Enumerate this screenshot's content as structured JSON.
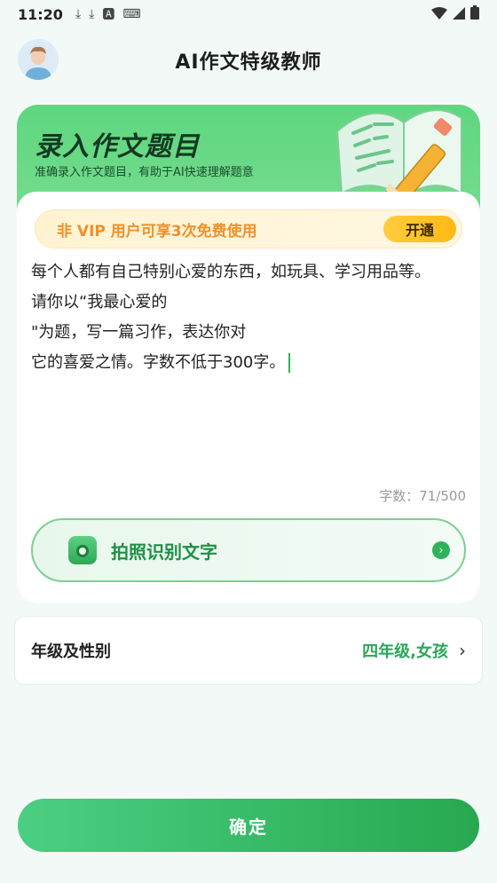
{
  "status": {
    "time": "11:20",
    "icons": [
      "download-icon",
      "download-icon",
      "font-icon",
      "keyboard-icon"
    ]
  },
  "header": {
    "title": "AI作文特级教师"
  },
  "card": {
    "title": "录入作文题目",
    "subtitle": "准确录入作文题目，有助于AI快速理解题意",
    "vip_text": "非 VIP 用户可享3次免费使用",
    "vip_button": "开通",
    "essay_text": "每个人都有自己特别心爱的东西，如玩具、学习用品等。\n请你以“我最心爱的\n\"为题，写一篇习作，表达你对\n它的喜爱之情。字数不低于300字。",
    "counter": "字数：71/500",
    "photo_label": "拍照识别文字"
  },
  "grade": {
    "label": "年级及性别",
    "value": "四年级,女孩"
  },
  "confirm": "确定",
  "colors": {
    "accent": "#2fb35a",
    "vip": "#f0902a"
  }
}
